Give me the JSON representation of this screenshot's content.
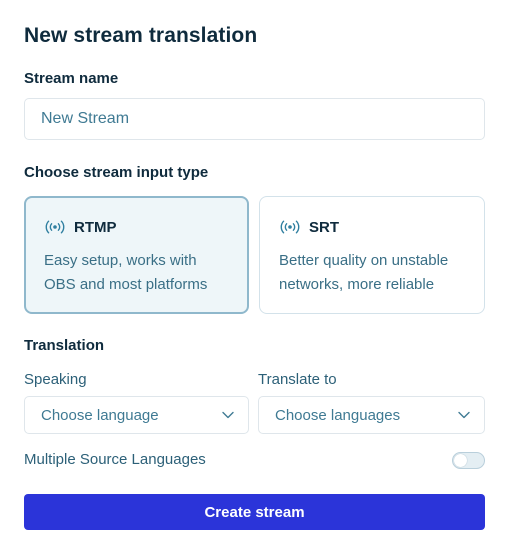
{
  "title": "New stream translation",
  "stream_name": {
    "label": "Stream name",
    "placeholder": "New Stream"
  },
  "input_type": {
    "label": "Choose stream input type",
    "options": [
      {
        "name": "RTMP",
        "description": "Easy setup, works with OBS and most platforms",
        "icon": "broadcast-icon",
        "selected": true
      },
      {
        "name": "SRT",
        "description": "Better quality on unstable networks, more reliable",
        "icon": "broadcast-icon",
        "selected": false
      }
    ]
  },
  "translation": {
    "label": "Translation",
    "speaking_label": "Speaking",
    "speaking_placeholder": "Choose language",
    "translate_to_label": "Translate to",
    "translate_to_placeholder": "Choose languages",
    "multiple_sources_label": "Multiple Source Languages",
    "multiple_sources_enabled": false
  },
  "create_button": "Create stream",
  "colors": {
    "accent": "#2b34d9",
    "selected_card_bg": "#eef6f9",
    "selected_card_border": "#8fb8cc",
    "heading": "#0f2b3d",
    "muted_text": "#3f7a93"
  }
}
